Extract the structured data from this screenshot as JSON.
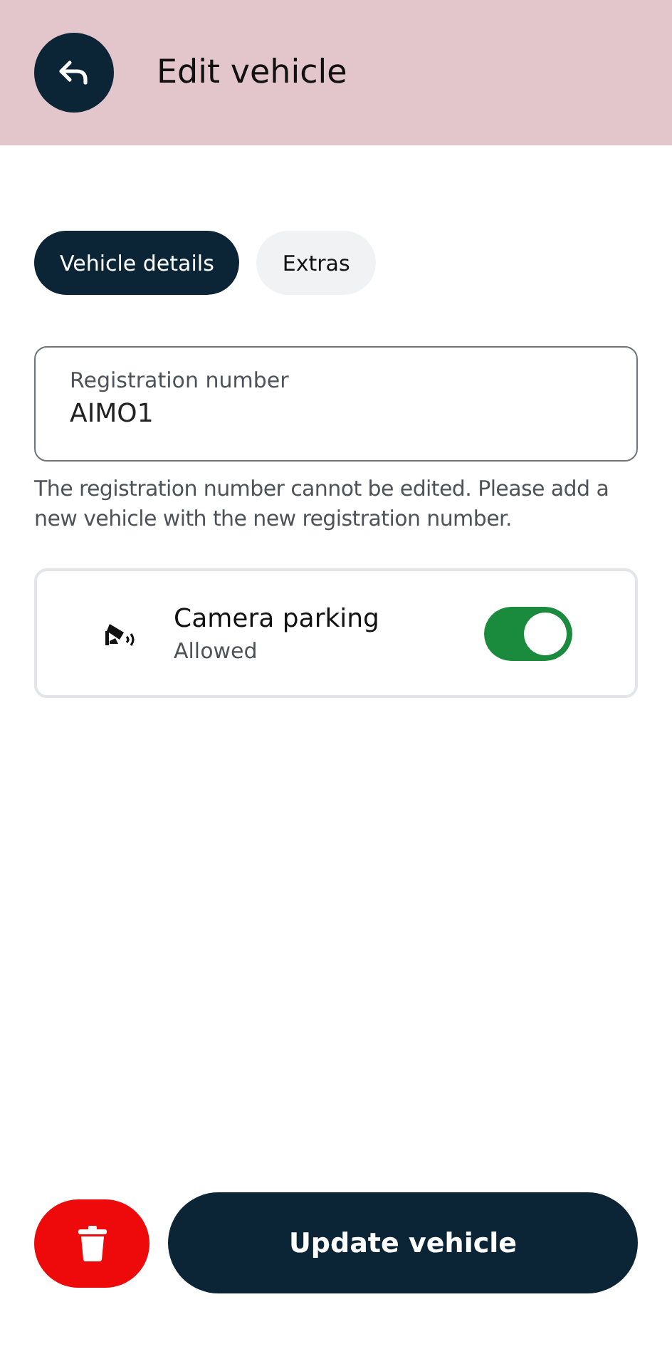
{
  "header": {
    "title": "Edit vehicle"
  },
  "tabs": [
    {
      "label": "Vehicle details",
      "selected": true
    },
    {
      "label": "Extras",
      "selected": false
    }
  ],
  "registration": {
    "label": "Registration number",
    "value": "AIMO1",
    "help": "The registration number cannot be edited. Please add a new vehicle with the new registration number."
  },
  "settings": [
    {
      "title": "Camera parking",
      "subtitle": "Allowed",
      "on": true
    }
  ],
  "actions": {
    "primary": "Update vehicle"
  }
}
